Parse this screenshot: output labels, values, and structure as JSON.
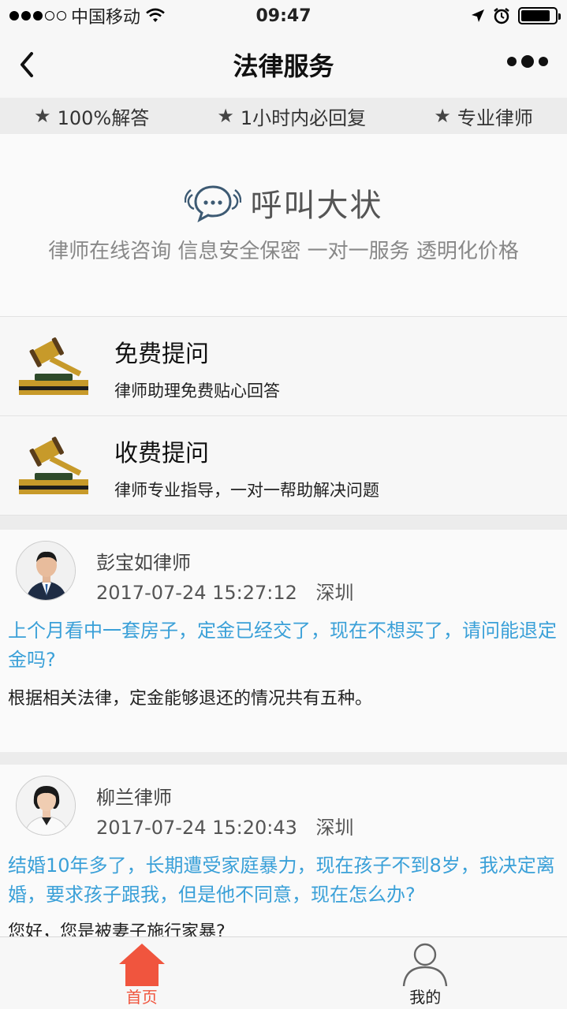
{
  "status_bar": {
    "carrier": "中国移动",
    "time": "09:47",
    "signal_dots_filled": 3,
    "signal_dots_total": 5,
    "battery_level": 0.85
  },
  "nav": {
    "title": "法律服务",
    "back_icon": "chevron-left-icon",
    "more_icon": "more-dots-icon"
  },
  "features": [
    {
      "icon": "star-icon",
      "label": "100%解答"
    },
    {
      "icon": "star-icon",
      "label": "1小时内必回复"
    },
    {
      "icon": "star-icon",
      "label": "专业律师"
    }
  ],
  "brand": {
    "name": "呼叫大状",
    "tagline": "律师在线咨询 信息安全保密 一对一服务 透明化价格",
    "logo_color": "#3d5a73"
  },
  "options": [
    {
      "icon": "gavel-icon",
      "title": "免费提问",
      "desc": "律师助理免费贴心回答"
    },
    {
      "icon": "gavel-icon",
      "title": "收费提问",
      "desc": "律师专业指导，一对一帮助解决问题"
    }
  ],
  "posts": [
    {
      "lawyer": "彭宝如律师",
      "datetime": "2017-07-24 15:27:12",
      "city": "深圳",
      "question": "上个月看中一套房子，定金已经交了，现在不想买了，请问能退定金吗?",
      "answer": "根据相关法律，定金能够退还的情况共有五种。"
    },
    {
      "lawyer": "柳兰律师",
      "datetime": "2017-07-24 15:20:43",
      "city": "深圳",
      "question": "结婚10年多了，长期遭受家庭暴力，现在孩子不到8岁，我决定离婚，要求孩子跟我，但是他不同意，现在怎么办?",
      "answer": "您好，您是被妻子施行家暴?"
    }
  ],
  "tabs": [
    {
      "label": "首页",
      "icon": "home-icon",
      "active": true
    },
    {
      "label": "我的",
      "icon": "user-icon",
      "active": false
    }
  ],
  "colors": {
    "accent": "#f0553e",
    "question_text": "#3aa0d8",
    "gavel": "#c79a2a"
  }
}
